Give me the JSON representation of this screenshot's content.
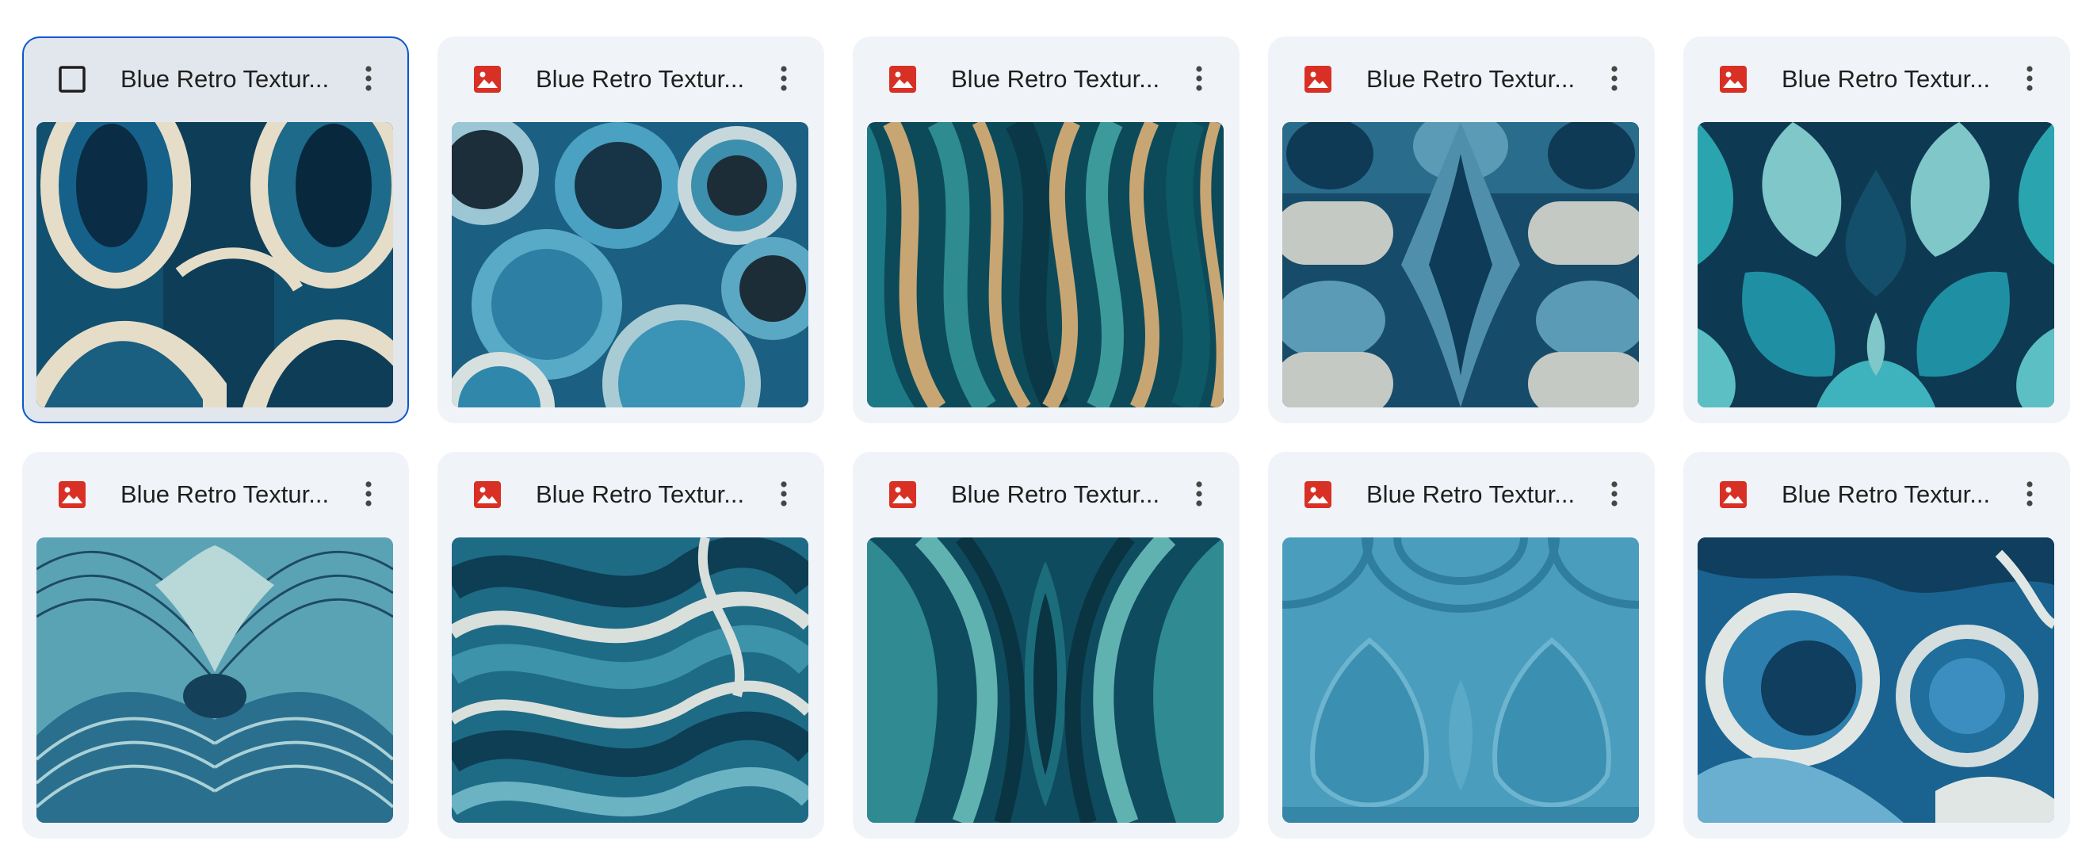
{
  "colors": {
    "file_icon_red": "#d93025",
    "card_bg": "#f0f4f9",
    "selected_bg": "#e2e7ee",
    "selected_border": "#0b57d0"
  },
  "files": [
    {
      "name": "Blue Retro Textur...",
      "icon": "checkbox-icon",
      "selected": true
    },
    {
      "name": "Blue Retro Textur...",
      "icon": "image-file-icon",
      "selected": false
    },
    {
      "name": "Blue Retro Textur...",
      "icon": "image-file-icon",
      "selected": false
    },
    {
      "name": "Blue Retro Textur...",
      "icon": "image-file-icon",
      "selected": false
    },
    {
      "name": "Blue Retro Textur...",
      "icon": "image-file-icon",
      "selected": false
    },
    {
      "name": "Blue Retro Textur...",
      "icon": "image-file-icon",
      "selected": false
    },
    {
      "name": "Blue Retro Textur...",
      "icon": "image-file-icon",
      "selected": false
    },
    {
      "name": "Blue Retro Textur...",
      "icon": "image-file-icon",
      "selected": false
    },
    {
      "name": "Blue Retro Textur...",
      "icon": "image-file-icon",
      "selected": false
    },
    {
      "name": "Blue Retro Textur...",
      "icon": "image-file-icon",
      "selected": false
    }
  ]
}
